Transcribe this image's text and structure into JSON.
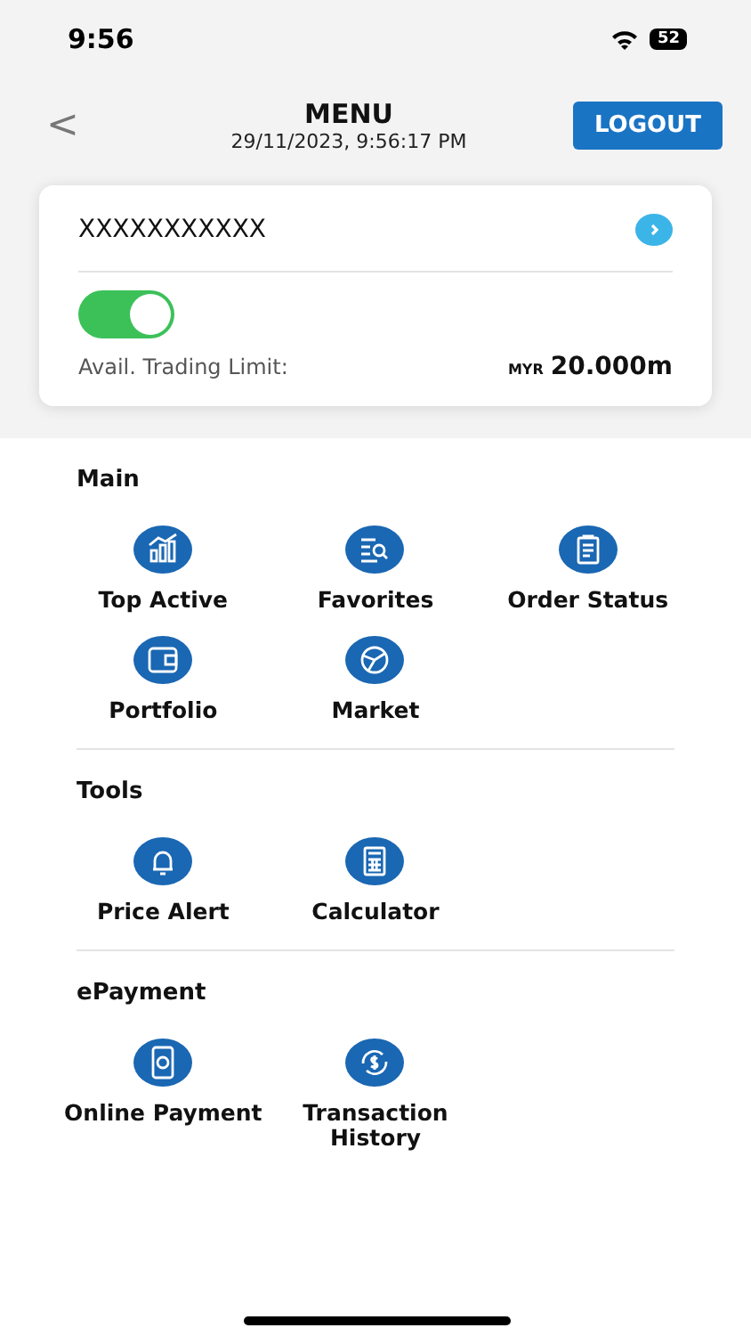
{
  "status_bar": {
    "time": "9:56",
    "battery": "52"
  },
  "header": {
    "back": "<",
    "title": "MENU",
    "datetime": "29/11/2023, 9:56:17 PM",
    "logout": "LOGOUT"
  },
  "account": {
    "name": "XXXXXXXXXXX",
    "toggle_on": true,
    "limit_label": "Avail. Trading Limit:",
    "currency": "MYR",
    "limit_value": "20.000m"
  },
  "sections": [
    {
      "title": "Main",
      "items": [
        {
          "label": "Top Active",
          "kind": "chart"
        },
        {
          "label": "Favorites",
          "kind": "search-list"
        },
        {
          "label": "Order Status",
          "kind": "clipboard"
        },
        {
          "label": "Portfolio",
          "kind": "wallet"
        },
        {
          "label": "Market",
          "kind": "pie"
        }
      ]
    },
    {
      "title": "Tools",
      "items": [
        {
          "label": "Price Alert",
          "kind": "bell"
        },
        {
          "label": "Calculator",
          "kind": "calculator"
        }
      ]
    },
    {
      "title": "ePayment",
      "items": [
        {
          "label": "Online Payment",
          "kind": "phone-pay"
        },
        {
          "label": "Transaction History",
          "kind": "dollar-cycle"
        }
      ]
    }
  ]
}
